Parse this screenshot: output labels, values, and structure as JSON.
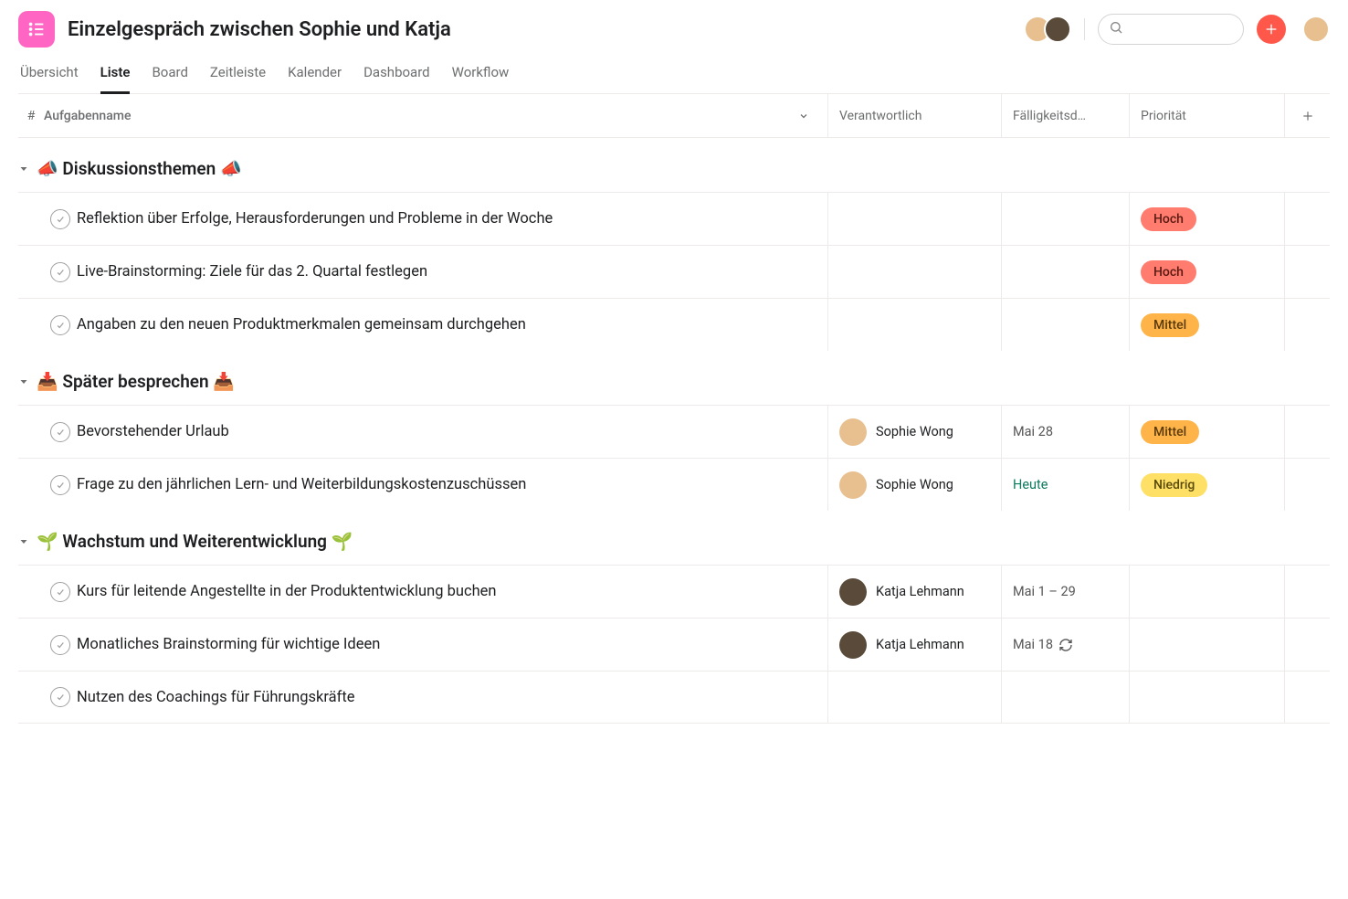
{
  "header": {
    "title": "Einzelgespräch zwischen Sophie und Katja",
    "search_placeholder": ""
  },
  "tabs": [
    {
      "label": "Übersicht",
      "active": false
    },
    {
      "label": "Liste",
      "active": true
    },
    {
      "label": "Board",
      "active": false
    },
    {
      "label": "Zeitleiste",
      "active": false
    },
    {
      "label": "Kalender",
      "active": false
    },
    {
      "label": "Dashboard",
      "active": false
    },
    {
      "label": "Workflow",
      "active": false
    }
  ],
  "columns": {
    "hash": "#",
    "name": "Aufgabenname",
    "assignee": "Verantwortlich",
    "due": "Fälligkeitsd…",
    "priority": "Priorität"
  },
  "priority_colors": {
    "Hoch": "#ff7c6e",
    "Mittel": "#ffb44a",
    "Niedrig": "#ffe066"
  },
  "sections": [
    {
      "title": "📣 Diskussionsthemen 📣",
      "tasks": [
        {
          "name": "Reflektion über Erfolge, Herausforderungen und Probleme in der Woche",
          "assignee": null,
          "due": null,
          "priority": "Hoch"
        },
        {
          "name": "Live-Brainstorming: Ziele für das 2. Quartal festlegen",
          "assignee": null,
          "due": null,
          "priority": "Hoch"
        },
        {
          "name": "Angaben zu den neuen Produktmerkmalen gemeinsam durchgehen",
          "assignee": null,
          "due": null,
          "priority": "Mittel"
        }
      ]
    },
    {
      "title": "📥 Später besprechen 📥",
      "tasks": [
        {
          "name": "Bevorstehender Urlaub",
          "assignee": "Sophie Wong",
          "avatar": "sophie",
          "due": "Mai 28",
          "priority": "Mittel"
        },
        {
          "name": "Frage zu den jährlichen Lern- und Weiterbildungskostenzuschüssen",
          "assignee": "Sophie Wong",
          "avatar": "sophie",
          "due": "Heute",
          "due_today": true,
          "priority": "Niedrig"
        }
      ]
    },
    {
      "title": "🌱 Wachstum und Weiterentwicklung 🌱",
      "tasks": [
        {
          "name": "Kurs für leitende Angestellte in der Produktentwicklung buchen",
          "assignee": "Katja Lehmann",
          "avatar": "katja",
          "due": "Mai 1 – 29",
          "priority": null
        },
        {
          "name": "Monatliches Brainstorming für wichtige Ideen",
          "assignee": "Katja Lehmann",
          "avatar": "katja",
          "due": "Mai 18",
          "recurring": true,
          "priority": null
        },
        {
          "name": "Nutzen des Coachings für Führungskräfte",
          "assignee": null,
          "due": null,
          "priority": null
        }
      ]
    }
  ]
}
